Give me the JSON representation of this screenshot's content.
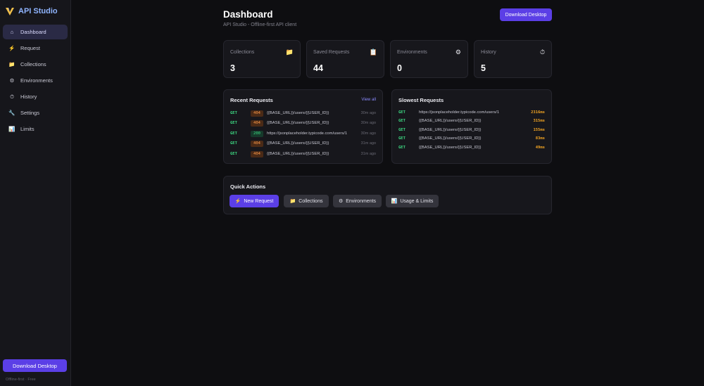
{
  "app": {
    "name": "API Studio"
  },
  "sidebar": {
    "items": [
      {
        "icon": "⌂",
        "label": "Dashboard"
      },
      {
        "icon": "⚡",
        "label": "Request"
      },
      {
        "icon": "📁",
        "label": "Collections"
      },
      {
        "icon": "⚙",
        "label": "Environments"
      },
      {
        "icon": "⏱",
        "label": "History"
      },
      {
        "icon": "🔧",
        "label": "Settings"
      },
      {
        "icon": "📊",
        "label": "Limits"
      }
    ],
    "download_label": "Download Desktop",
    "footer": "Offline-first · Free"
  },
  "header": {
    "title": "Dashboard",
    "subtitle": "API Studio - Offline-first API client",
    "download_label": "Download Desktop"
  },
  "stats": [
    {
      "label": "Collections",
      "icon": "📁",
      "value": "3"
    },
    {
      "label": "Saved Requests",
      "icon": "📋",
      "value": "44"
    },
    {
      "label": "Environments",
      "icon": "⚙",
      "value": "0"
    },
    {
      "label": "History",
      "icon": "⏱",
      "value": "5"
    }
  ],
  "recent": {
    "title": "Recent Requests",
    "view_all": "View all",
    "rows": [
      {
        "method": "GET",
        "status": "404",
        "url": "{{BASE_URL}}/users/{{USER_ID}}",
        "ago": "30m ago"
      },
      {
        "method": "GET",
        "status": "404",
        "url": "{{BASE_URL}}/users/{{USER_ID}}",
        "ago": "30m ago"
      },
      {
        "method": "GET",
        "status": "200",
        "url": "https://jsonplaceholder.typicode.com/users/1",
        "ago": "30m ago"
      },
      {
        "method": "GET",
        "status": "404",
        "url": "{{BASE_URL}}/users/{{USER_ID}}",
        "ago": "31m ago"
      },
      {
        "method": "GET",
        "status": "404",
        "url": "{{BASE_URL}}/users/{{USER_ID}}",
        "ago": "31m ago"
      }
    ]
  },
  "slowest": {
    "title": "Slowest Requests",
    "rows": [
      {
        "method": "GET",
        "url": "https://jsonplaceholder.typicode.com/users/1",
        "duration": "2316ms"
      },
      {
        "method": "GET",
        "url": "{{BASE_URL}}/users/{{USER_ID}}",
        "duration": "315ms"
      },
      {
        "method": "GET",
        "url": "{{BASE_URL}}/users/{{USER_ID}}",
        "duration": "155ms"
      },
      {
        "method": "GET",
        "url": "{{BASE_URL}}/users/{{USER_ID}}",
        "duration": "83ms"
      },
      {
        "method": "GET",
        "url": "{{BASE_URL}}/users/{{USER_ID}}",
        "duration": "49ms"
      }
    ]
  },
  "quick_actions": {
    "title": "Quick Actions",
    "buttons": [
      {
        "icon": "⚡",
        "label": "New Request"
      },
      {
        "icon": "📁",
        "label": "Collections"
      },
      {
        "icon": "⚙",
        "label": "Environments"
      },
      {
        "icon": "📊",
        "label": "Usage & Limits"
      }
    ]
  },
  "colors": {
    "accent": "#5b3fe6",
    "success": "#3ddc84",
    "warning": "#ff9a4a",
    "duration": "#f5a623"
  }
}
